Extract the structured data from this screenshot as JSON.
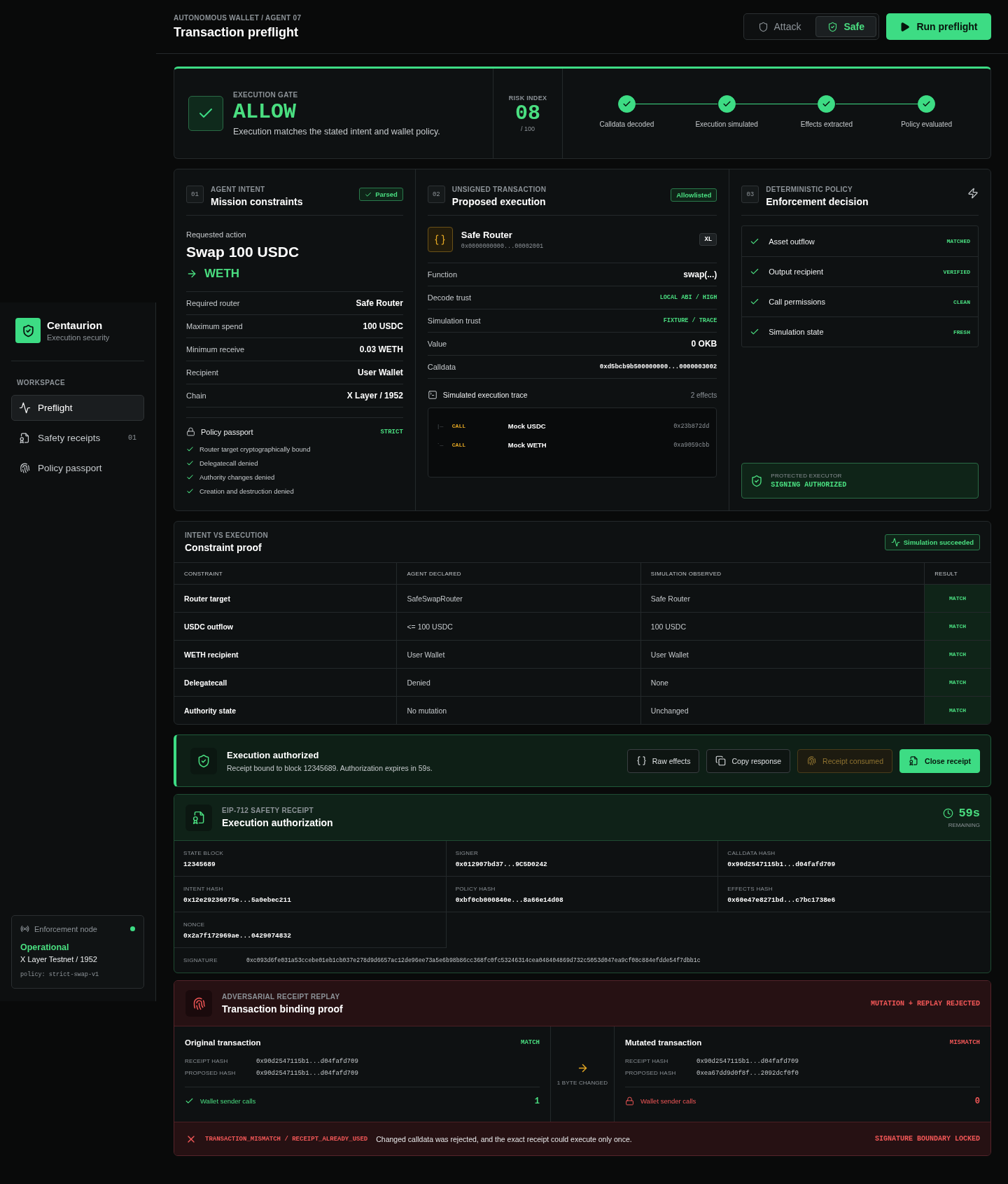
{
  "sidebar": {
    "brand": {
      "name": "Centaurion",
      "tagline": "Execution security"
    },
    "section": "WORKSPACE",
    "items": [
      {
        "label": "Preflight",
        "selected": true
      },
      {
        "label": "Safety receipts",
        "count": "01",
        "selected": false
      },
      {
        "label": "Policy passport",
        "selected": false
      }
    ],
    "node": {
      "label": "Enforcement node",
      "online": true,
      "status": "Operational",
      "network": "X Layer Testnet / 1952",
      "policy": "policy: strict-swap-v1"
    }
  },
  "header": {
    "breadcrumb": "AUTONOMOUS WALLET / AGENT 07",
    "title": "Transaction preflight",
    "modes": [
      {
        "label": "Attack",
        "selected": false
      },
      {
        "label": "Safe",
        "selected": true
      }
    ],
    "run_button": "Run preflight"
  },
  "gate": {
    "label": "EXECUTION GATE",
    "verdict": "ALLOW",
    "allowed": true,
    "description": "Execution matches the stated intent and wallet policy.",
    "risk": {
      "label": "RISK INDEX",
      "value": "08",
      "scale": "/ 100"
    },
    "steps": [
      {
        "label": "Calldata decoded",
        "done": true
      },
      {
        "label": "Execution simulated",
        "done": true
      },
      {
        "label": "Effects extracted",
        "done": true
      },
      {
        "label": "Policy evaluated",
        "done": true
      }
    ]
  },
  "intent": {
    "number": "01",
    "eyebrow": "AGENT INTENT",
    "title": "Mission constraints",
    "badge": "Parsed",
    "requested_label": "Requested action",
    "action": "Swap 100 USDC",
    "target": "WETH",
    "rows": [
      {
        "label": "Required router",
        "value": "Safe Router"
      },
      {
        "label": "Maximum spend",
        "value": "100 USDC"
      },
      {
        "label": "Minimum receive",
        "value": "0.03 WETH"
      },
      {
        "label": "Recipient",
        "value": "User Wallet"
      },
      {
        "label": "Chain",
        "value": "X Layer / 1952"
      }
    ],
    "passport": {
      "title": "Policy passport",
      "level": "STRICT",
      "rules": [
        {
          "text": "Router target cryptographically bound",
          "ok": true
        },
        {
          "text": "Delegatecall denied",
          "ok": true
        },
        {
          "text": "Authority changes denied",
          "ok": true
        },
        {
          "text": "Creation and destruction denied",
          "ok": true
        }
      ]
    }
  },
  "transaction": {
    "number": "02",
    "eyebrow": "UNSIGNED TRANSACTION",
    "title": "Proposed execution",
    "badge": "Allowlisted",
    "contract": {
      "name": "Safe Router",
      "address": "0x0000000000...00002001",
      "tag": "XL"
    },
    "rows": [
      {
        "label": "Function",
        "value": "swap(...)",
        "kind": "plain"
      },
      {
        "label": "Decode trust",
        "value": "LOCAL ABI / HIGH",
        "kind": "tag"
      },
      {
        "label": "Simulation trust",
        "value": "FIXTURE / TRACE",
        "kind": "tag"
      },
      {
        "label": "Value",
        "value": "0 OKB",
        "kind": "plain"
      },
      {
        "label": "Calldata",
        "value": "0xd5bcb9b500000000...0000003002",
        "kind": "mono"
      }
    ],
    "trace": {
      "title": "Simulated execution trace",
      "count": "2 effects",
      "calls": [
        {
          "branch": "|—",
          "op": "CALL",
          "target": "Mock USDC",
          "selector": "0x23b872dd"
        },
        {
          "branch": "`—",
          "op": "CALL",
          "target": "Mock WETH",
          "selector": "0xa9059cbb"
        }
      ]
    }
  },
  "policy": {
    "number": "03",
    "eyebrow": "DETERMINISTIC POLICY",
    "title": "Enforcement decision",
    "checks": [
      {
        "label": "Asset outflow",
        "result": "MATCHED",
        "passed": true
      },
      {
        "label": "Output recipient",
        "result": "VERIFIED",
        "passed": true
      },
      {
        "label": "Call permissions",
        "result": "CLEAN",
        "passed": true
      },
      {
        "label": "Simulation state",
        "result": "FRESH",
        "passed": true
      }
    ],
    "executor": {
      "label": "PROTECTED EXECUTOR",
      "status": "SIGNING AUTHORIZED"
    }
  },
  "proof": {
    "eyebrow": "INTENT VS EXECUTION",
    "title": "Constraint proof",
    "badge": "Simulation succeeded",
    "columns": [
      "CONSTRAINT",
      "AGENT DECLARED",
      "SIMULATION OBSERVED",
      "RESULT"
    ],
    "rows": [
      {
        "constraint": "Router target",
        "declared": "SafeSwapRouter",
        "observed": "Safe Router",
        "result": "MATCH",
        "passed": true
      },
      {
        "constraint": "USDC outflow",
        "declared": "<= 100 USDC",
        "observed": "100 USDC",
        "result": "MATCH",
        "passed": true
      },
      {
        "constraint": "WETH recipient",
        "declared": "User Wallet",
        "observed": "User Wallet",
        "result": "MATCH",
        "passed": true
      },
      {
        "constraint": "Delegatecall",
        "declared": "Denied",
        "observed": "None",
        "result": "MATCH",
        "passed": true
      },
      {
        "constraint": "Authority state",
        "declared": "No mutation",
        "observed": "Unchanged",
        "result": "MATCH",
        "passed": true
      }
    ]
  },
  "authorization": {
    "title": "Execution authorized",
    "description": "Receipt bound to block 12345689. Authorization expires in 59s.",
    "actions": [
      {
        "label": "Raw effects",
        "primary": false,
        "disabled": false
      },
      {
        "label": "Copy response",
        "primary": false,
        "disabled": false
      },
      {
        "label": "Receipt consumed",
        "primary": false,
        "disabled": true
      },
      {
        "label": "Close receipt",
        "primary": true,
        "disabled": false
      }
    ]
  },
  "receipt": {
    "eyebrow": "EIP-712 SAFETY RECEIPT",
    "title": "Execution authorization",
    "countdown": "59s",
    "countdown_label": "REMAINING",
    "fields": [
      {
        "label": "STATE BLOCK",
        "value": "12345689"
      },
      {
        "label": "SIGNER",
        "value": "0x012907bd37...9C5D0242"
      },
      {
        "label": "CALLDATA HASH",
        "value": "0x90d2547115b1...d04fafd709"
      },
      {
        "label": "INTENT HASH",
        "value": "0x12e29236075e...5a0ebec211"
      },
      {
        "label": "POLICY HASH",
        "value": "0xbf0cb000840e...8a66e14d08"
      },
      {
        "label": "EFFECTS HASH",
        "value": "0x60e47e8271bd...c7bc1738e6"
      },
      {
        "label": "NONCE",
        "value": "0x2a7f172969ae...0429074832"
      }
    ],
    "signature": {
      "label": "SIGNATURE",
      "value": "0xc093d6fe031a53ccebe01eb1cb037e278d9d6657ac12de96ee73a5e6b98b86cc368fc0fc53246314cea048404869d732c5053d047ea9cf08c884efdde54f7dbb1c"
    }
  },
  "replay": {
    "eyebrow": "ADVERSARIAL RECEIPT REPLAY",
    "title": "Transaction binding proof",
    "verdict": "MUTATION + REPLAY REJECTED",
    "transactions": [
      {
        "title": "Original transaction",
        "status": "MATCH",
        "matched": true,
        "rows": [
          {
            "label": "RECEIPT HASH",
            "value": "0x90d2547115b1...d04fafd709"
          },
          {
            "label": "PROPOSED HASH",
            "value": "0x90d2547115b1...d04fafd709"
          }
        ],
        "calls_label": "Wallet sender calls",
        "calls": "1"
      },
      {
        "title": "Mutated transaction",
        "status": "MISMATCH",
        "matched": false,
        "rows": [
          {
            "label": "RECEIPT HASH",
            "value": "0x90d2547115b1...d04fafd709"
          },
          {
            "label": "PROPOSED HASH",
            "value": "0xea67dd9d0f8f...2092dcf0f0"
          }
        ],
        "calls_label": "Wallet sender calls",
        "calls": "0"
      }
    ],
    "change": "1 BYTE CHANGED",
    "error": {
      "code": "TRANSACTION_MISMATCH / RECEIPT_ALREADY_USED",
      "message": "Changed calldata was rejected, and the exact receipt could execute only once.",
      "status": "SIGNATURE BOUNDARY LOCKED"
    }
  }
}
